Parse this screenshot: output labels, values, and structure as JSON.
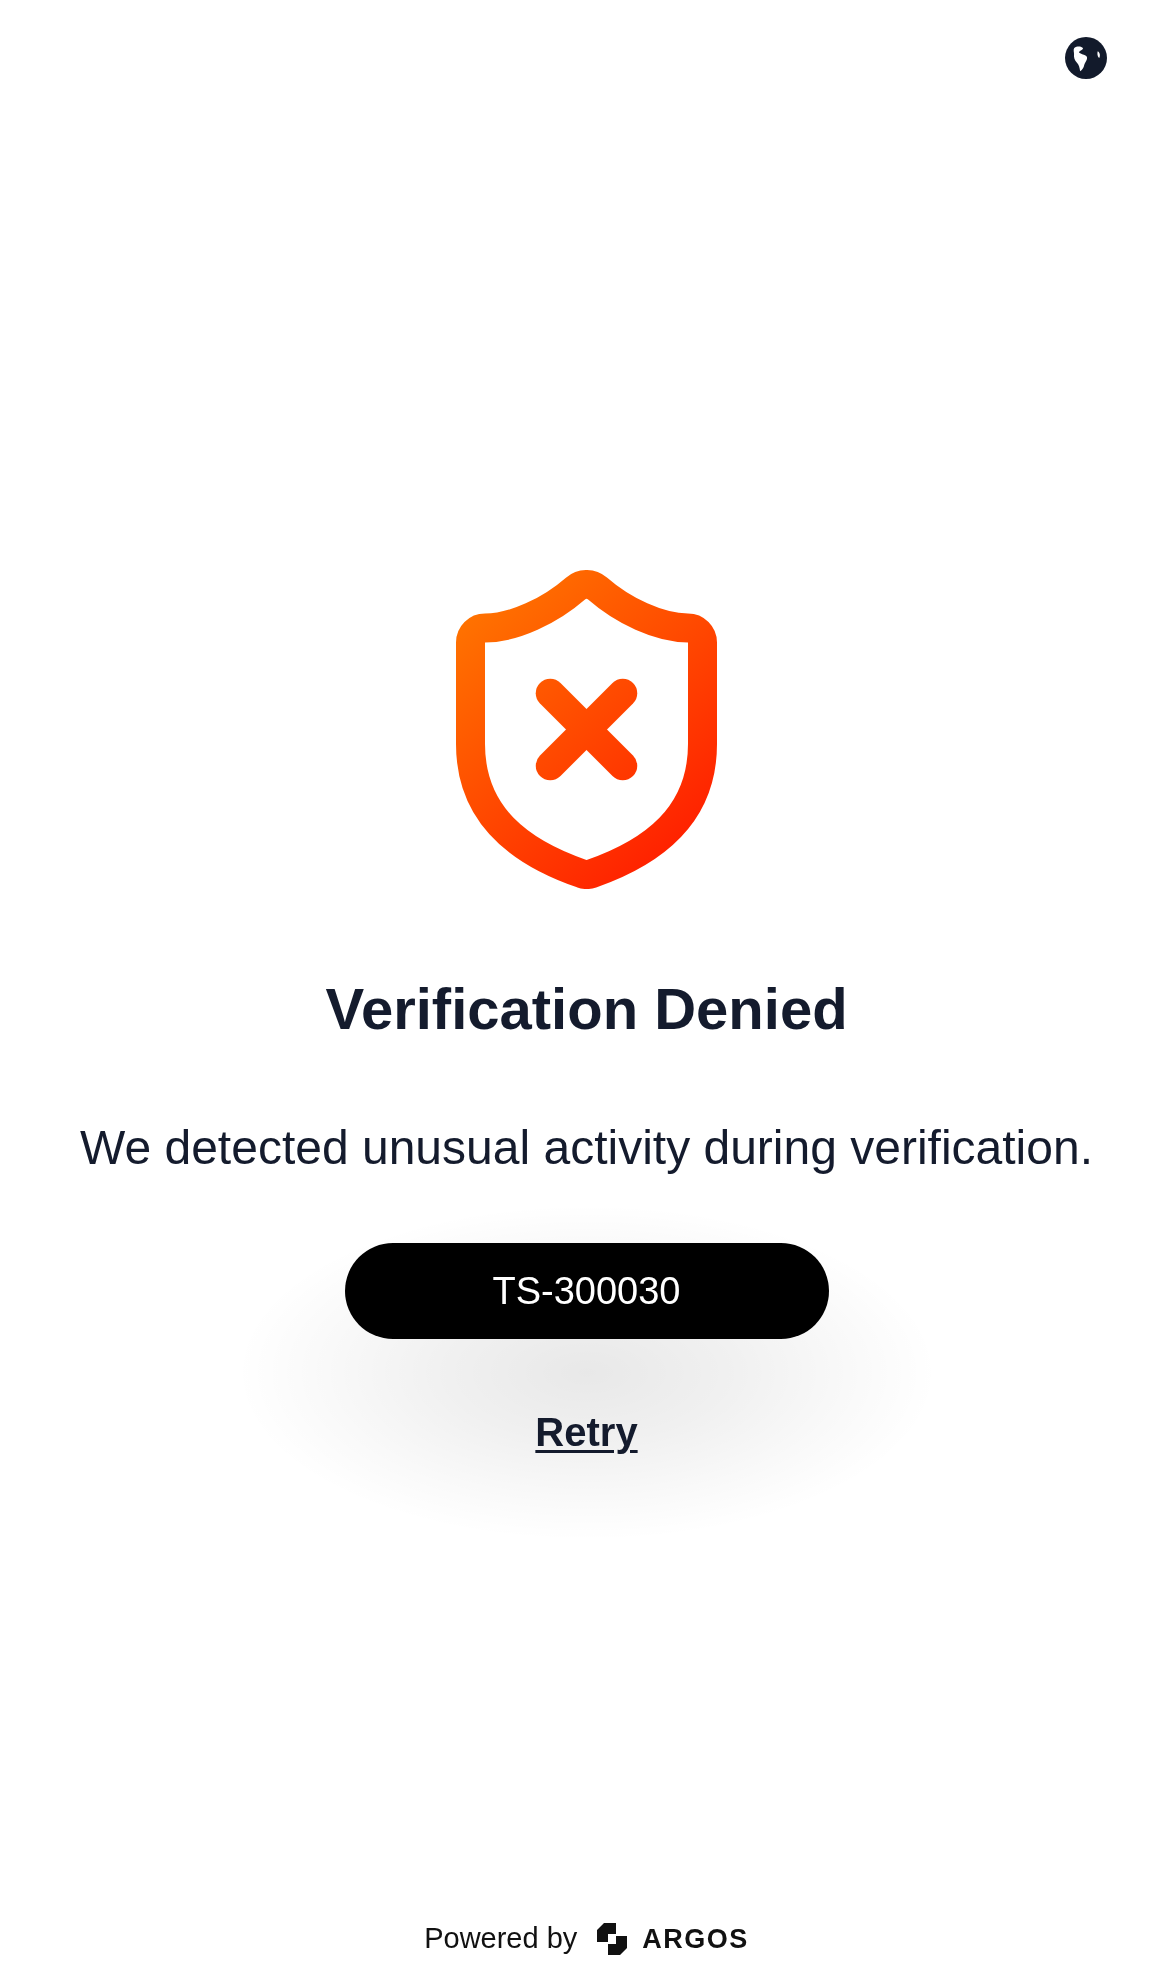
{
  "status": {
    "title": "Verification Denied",
    "message": "We detected unusual activity during verification."
  },
  "actions": {
    "error_code": "TS-300030",
    "retry_link": "Retry"
  },
  "footer": {
    "powered_by": "Powered by",
    "brand": "ARGOS"
  }
}
